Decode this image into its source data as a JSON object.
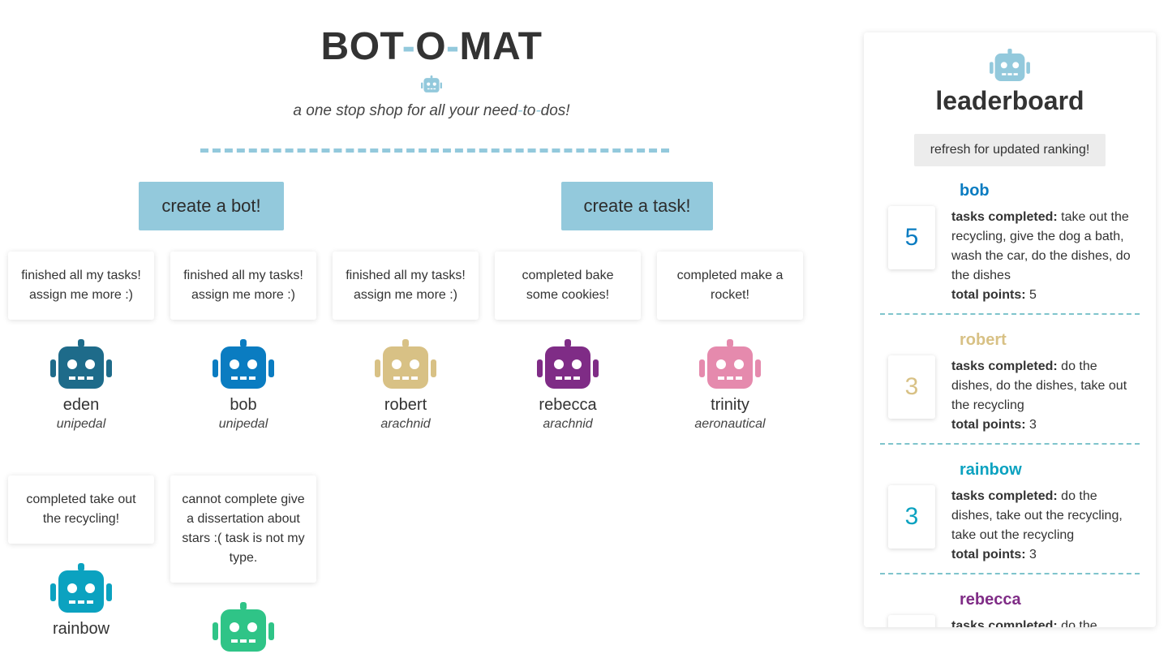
{
  "header": {
    "title_parts": [
      "BOT",
      "-",
      "O",
      "-",
      "MAT"
    ],
    "tagline_parts": [
      "a one stop shop for all your need",
      "-",
      "to",
      "-",
      "dos!"
    ],
    "icon": "robot-icon",
    "accent_color": "#93c9dc"
  },
  "buttons": {
    "create_bot": "create a bot!",
    "create_task": "create a task!"
  },
  "bots": [
    {
      "message": "finished all my tasks! assign me more :)",
      "name": "eden",
      "type": "unipedal",
      "color": "#1e6b8a"
    },
    {
      "message": "finished all my tasks! assign me more :)",
      "name": "bob",
      "type": "unipedal",
      "color": "#0a7cc1"
    },
    {
      "message": "finished all my tasks! assign me more :)",
      "name": "robert",
      "type": "arachnid",
      "color": "#d8c185"
    },
    {
      "message": "completed bake some cookies!",
      "name": "rebecca",
      "type": "arachnid",
      "color": "#7f2c86"
    },
    {
      "message": "completed make a rocket!",
      "name": "trinity",
      "type": "aeronautical",
      "color": "#e58aad"
    },
    {
      "message": "completed take out the recycling!",
      "name": "rainbow",
      "type": "",
      "color": "#0ba2c0"
    },
    {
      "message": "cannot complete give a dissertation about stars :( task is not my type.",
      "name": "",
      "type": "",
      "color": "#2fc487"
    }
  ],
  "leaderboard": {
    "title": "leaderboard",
    "icon": "robot-icon",
    "refresh_label": "refresh for updated ranking!",
    "tasks_label": "tasks completed:",
    "points_label": "total points:",
    "entries": [
      {
        "name": "bob",
        "score": "5",
        "tasks": "take out the recycling, give the dog a bath, wash the car, do the dishes, do the dishes",
        "points": "5",
        "color": "#0a7cc1"
      },
      {
        "name": "robert",
        "score": "3",
        "tasks": "do the dishes, do the dishes, take out the recycling",
        "points": "3",
        "color": "#d8c185"
      },
      {
        "name": "rainbow",
        "score": "3",
        "tasks": "do the dishes, take out the recycling, take out the recycling",
        "points": "3",
        "color": "#0ba2c0"
      },
      {
        "name": "rebecca",
        "score": "",
        "tasks": "do the",
        "points": "",
        "color": "#7f2c86"
      }
    ]
  }
}
